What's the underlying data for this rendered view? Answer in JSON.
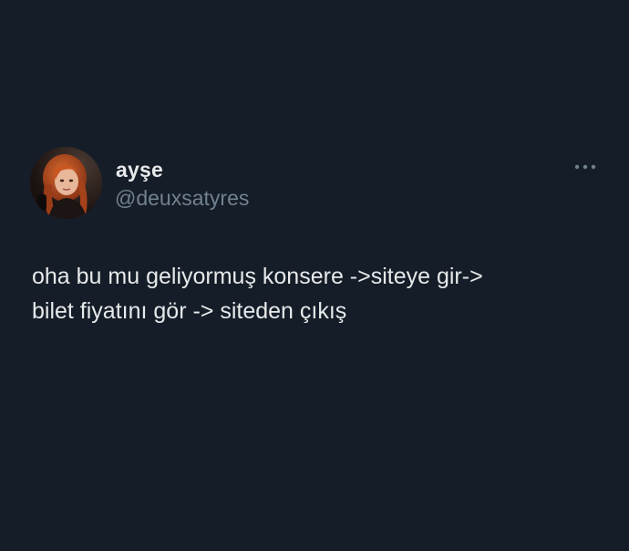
{
  "tweet": {
    "author": {
      "display_name": "ayşe",
      "handle": "@deuxsatyres",
      "avatar_icon": "profile-photo"
    },
    "more_icon": "more-horizontal-icon",
    "text_lines": [
      "oha bu mu geliyormuş konsere ->siteye gir->",
      "bilet fiyatını gör -> siteden çıkış"
    ]
  },
  "colors": {
    "background": "#151d28",
    "primary_text": "#e7e9ea",
    "secondary_text": "#71818f"
  }
}
